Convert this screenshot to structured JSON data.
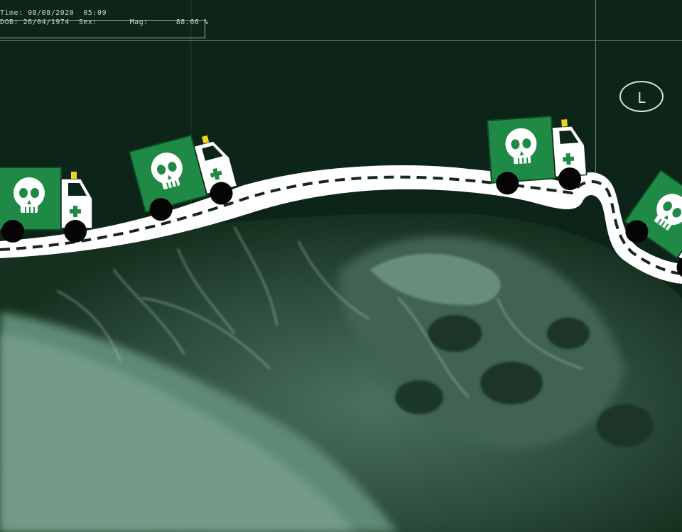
{
  "hud": {
    "line1": "Time: 08/08/2020  05:09",
    "line2": "DOB: 26/04/1974  Sex:       Mag:      88.66 %"
  },
  "side_marker": "L",
  "colors": {
    "background": "#0d2418",
    "road": "#ffffff",
    "road_dash": "#14281d",
    "truck_green": "#1f8a45",
    "cross_green": "#1f8a45",
    "beacon": "#f2d21b",
    "tissue": "#8fb3a0"
  },
  "vehicles": [
    {
      "icon": "skull-icon",
      "badge": "cross-icon"
    },
    {
      "icon": "skull-icon",
      "badge": "cross-icon"
    },
    {
      "icon": "skull-icon",
      "badge": "cross-icon"
    },
    {
      "icon": "skull-icon",
      "badge": "cross-icon"
    }
  ]
}
